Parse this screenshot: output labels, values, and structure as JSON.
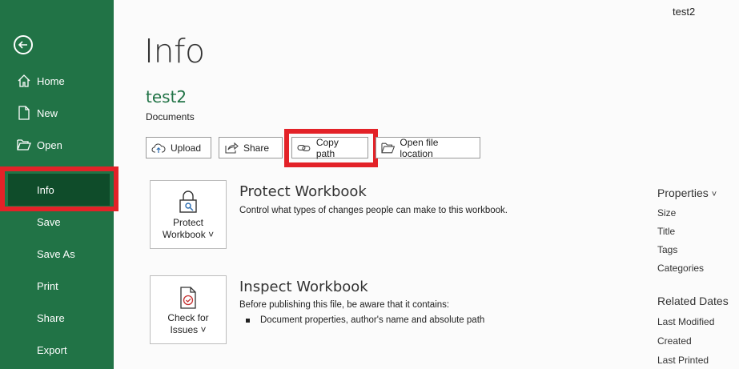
{
  "window": {
    "doc_name": "test2"
  },
  "sidebar": {
    "items": [
      {
        "label": "Home"
      },
      {
        "label": "New"
      },
      {
        "label": "Open"
      },
      {
        "label": "Info"
      },
      {
        "label": "Save"
      },
      {
        "label": "Save As"
      },
      {
        "label": "Print"
      },
      {
        "label": "Share"
      },
      {
        "label": "Export"
      }
    ],
    "active": "Info",
    "accent": "#217346",
    "active_bg": "#0f4c2a"
  },
  "main": {
    "title": "Info",
    "file_name": "test2",
    "file_location": "Documents",
    "actions": [
      {
        "label": "Upload",
        "icon": "upload-cloud-icon"
      },
      {
        "label": "Share",
        "icon": "share-icon"
      },
      {
        "label": "Copy path",
        "icon": "link-icon"
      },
      {
        "label": "Open file location",
        "icon": "folder-icon"
      }
    ],
    "protect": {
      "tile_line1": "Protect",
      "tile_line2": "Workbook",
      "chevron": "˅",
      "title": "Protect Workbook",
      "desc": "Control what types of changes people can make to this workbook."
    },
    "inspect": {
      "tile_line1": "Check for",
      "tile_line2": "Issues",
      "chevron": "˅",
      "title": "Inspect Workbook",
      "desc": "Before publishing this file, be aware that it contains:",
      "bullets": [
        "Document properties, author's name and absolute path"
      ]
    }
  },
  "right_panel": {
    "properties_label": "Properties",
    "properties_chevron": "˅",
    "properties": [
      "Size",
      "Title",
      "Tags",
      "Categories"
    ],
    "related_dates_label": "Related Dates",
    "related_dates": [
      "Last Modified",
      "Created",
      "Last Printed"
    ]
  },
  "highlight_color": "#e32228"
}
